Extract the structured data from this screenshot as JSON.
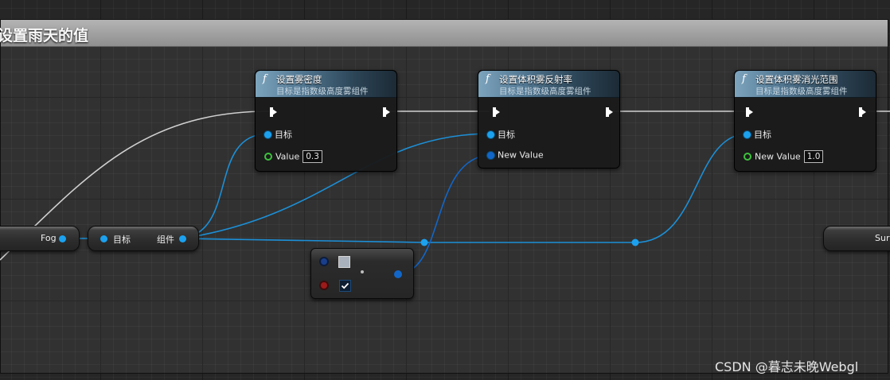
{
  "comment": {
    "title": "设置雨天的值"
  },
  "nodes": [
    {
      "fn_icon": "f",
      "title": "设置雾密度",
      "subtitle": "目标是指数级高度雾组件",
      "target_label": "目标",
      "value_label": "Value",
      "value": "0.3"
    },
    {
      "fn_icon": "f",
      "title": "设置体积雾反射率",
      "subtitle": "目标是指数级高度雾组件",
      "target_label": "目标",
      "value_label": "New Value"
    },
    {
      "fn_icon": "f",
      "title": "设置体积雾消光范围",
      "subtitle": "目标是指数级高度雾组件",
      "target_label": "目标",
      "value_label": "New Value",
      "value": "1.0"
    }
  ],
  "fog_var": {
    "label": "Fog"
  },
  "get_component": {
    "target_label": "目标",
    "output_label": "组件"
  },
  "cut_node": {
    "label": "Sur"
  },
  "select_node": {
    "checkbox_checked": true
  },
  "colors": {
    "object_pin": "#1ca1ee",
    "float_pin": "#3dc23d",
    "header_blue": "#557b96"
  },
  "watermark": "CSDN @暮志未晚Webgl"
}
